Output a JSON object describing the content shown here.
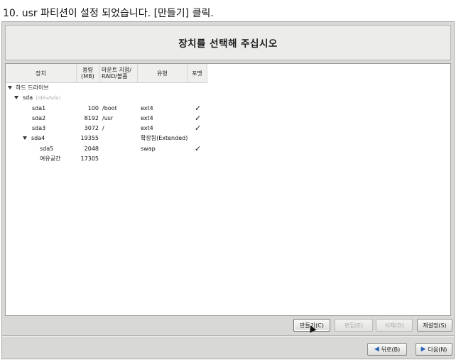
{
  "caption": "10. usr 파티션이 설정 되었습니다. [만들기] 클릭.",
  "header": {
    "title": "장치를 선택해 주십시오"
  },
  "table": {
    "columns": {
      "device": "장치",
      "size_line1": "용량",
      "size_line2": "(MB)",
      "mount_line1": "마운트 지점/",
      "mount_line2": "RAID/볼륨",
      "type": "유형",
      "format": "포맷"
    },
    "tree": {
      "hard_drives": "하드 드라이브",
      "sda_label": "sda",
      "sda_path": "(/dev/sda)"
    },
    "rows": [
      {
        "device": "sda1",
        "size": "100",
        "mount": "/boot",
        "type": "ext4",
        "format": "✓"
      },
      {
        "device": "sda2",
        "size": "8192",
        "mount": "/usr",
        "type": "ext4",
        "format": "✓"
      },
      {
        "device": "sda3",
        "size": "3072",
        "mount": "/",
        "type": "ext4",
        "format": "✓"
      },
      {
        "device": "sda4",
        "size": "19355",
        "mount": "",
        "type": "확장됨(Extended)",
        "format": ""
      },
      {
        "device": "sda5",
        "size": "2048",
        "mount": "",
        "type": "swap",
        "format": "✓"
      },
      {
        "device": "여유공간",
        "size": "17305",
        "mount": "",
        "type": "",
        "format": ""
      }
    ]
  },
  "buttons": {
    "create": "만들기(C)",
    "edit": "편집(E)",
    "delete": "삭제(D)",
    "reset": "재설정(S)",
    "back": "뒤로(B)",
    "next": "다음(N)"
  }
}
